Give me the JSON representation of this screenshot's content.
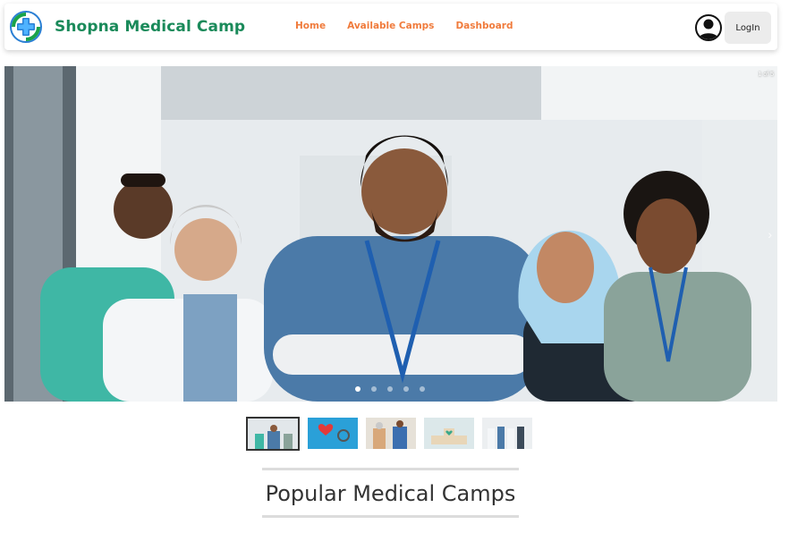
{
  "navbar": {
    "brand_name": "Shopna Medical Camp",
    "logo_icon": "medical-cross-logo-icon",
    "links": [
      "Home",
      "Available Camps",
      "Dashboard"
    ],
    "user_icon": "user-avatar-icon",
    "login_label": "LogIn"
  },
  "carousel": {
    "counter": "1 of 5",
    "active_index": 0,
    "total": 5,
    "next_icon": "chevron-right-icon"
  },
  "thumbnails": [
    "doctors-team",
    "stethoscope-heart",
    "elderly-care",
    "medical-blocks",
    "staff-group"
  ],
  "section": {
    "title": "Popular Medical Camps"
  },
  "colors": {
    "brand": "#1a8a5a",
    "nav_link": "#f07b3c"
  }
}
